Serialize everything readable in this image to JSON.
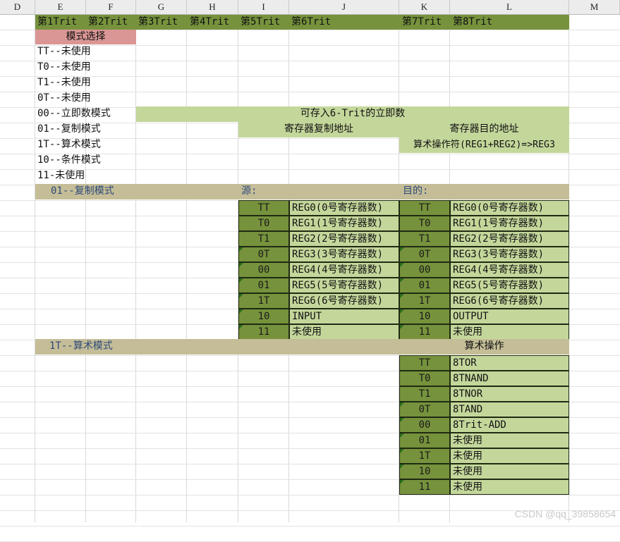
{
  "columns": [
    "D",
    "E",
    "F",
    "G",
    "H",
    "I",
    "J",
    "K",
    "L",
    "M"
  ],
  "header_row": [
    "第1Trit",
    "第2Trit",
    "第3Trit",
    "第4Trit",
    "第5Trit",
    "第6Trit",
    "第7Trit",
    "第8Trit"
  ],
  "mode_select_label": "模式选择",
  "modes": [
    "TT--未使用",
    "T0--未使用",
    "T1--未使用",
    "0T--未使用",
    "00--立即数模式",
    "01--复制模式",
    "1T--算术模式",
    "10--条件模式",
    "11-未使用"
  ],
  "immediate_text": "可存入6-Trit的立即数",
  "copy_src_addr": "寄存器复制地址",
  "dest_addr": "寄存器目的地址",
  "arith_desc": "算术操作符(REG1+REG2)=>REG3",
  "copy_section": {
    "title": "01--复制模式",
    "src_label": "源:",
    "dst_label": "目的:",
    "src_rows": [
      {
        "code": "TT",
        "desc": "REG0(0号寄存器数)"
      },
      {
        "code": "T0",
        "desc": "REG1(1号寄存器数)"
      },
      {
        "code": "T1",
        "desc": "REG2(2号寄存器数)"
      },
      {
        "code": "0T",
        "desc": "REG3(3号寄存器数)"
      },
      {
        "code": "00",
        "desc": "REG4(4号寄存器数)"
      },
      {
        "code": "01",
        "desc": "REG5(5号寄存器数)"
      },
      {
        "code": "1T",
        "desc": "REG6(6号寄存器数)"
      },
      {
        "code": "10",
        "desc": "INPUT"
      },
      {
        "code": "11",
        "desc": "未使用"
      }
    ],
    "dst_rows": [
      {
        "code": "TT",
        "desc": "REG0(0号寄存器数)"
      },
      {
        "code": "T0",
        "desc": "REG1(1号寄存器数)"
      },
      {
        "code": "T1",
        "desc": "REG2(2号寄存器数)"
      },
      {
        "code": "0T",
        "desc": "REG3(3号寄存器数)"
      },
      {
        "code": "00",
        "desc": "REG4(4号寄存器数)"
      },
      {
        "code": "01",
        "desc": "REG5(5号寄存器数)"
      },
      {
        "code": "1T",
        "desc": "REG6(6号寄存器数)"
      },
      {
        "code": "10",
        "desc": "OUTPUT"
      },
      {
        "code": "11",
        "desc": "未使用"
      }
    ]
  },
  "arith_section": {
    "title": "1T--算术模式",
    "op_label": "算术操作",
    "rows": [
      {
        "code": "TT",
        "desc": "8TOR"
      },
      {
        "code": "T0",
        "desc": "8TNAND"
      },
      {
        "code": "T1",
        "desc": "8TNOR"
      },
      {
        "code": "0T",
        "desc": "8TAND"
      },
      {
        "code": "00",
        "desc": "8Trit-ADD"
      },
      {
        "code": "01",
        "desc": "未使用"
      },
      {
        "code": "1T",
        "desc": "未使用"
      },
      {
        "code": "10",
        "desc": "未使用"
      },
      {
        "code": "11",
        "desc": "未使用"
      }
    ]
  },
  "watermark": "CSDN @qq_39858654",
  "colors": {
    "dark_green": "#76923c",
    "light_green": "#c4d79b",
    "tan": "#c4bd97",
    "pink": "#da9694",
    "olive_header": "#76923c"
  }
}
